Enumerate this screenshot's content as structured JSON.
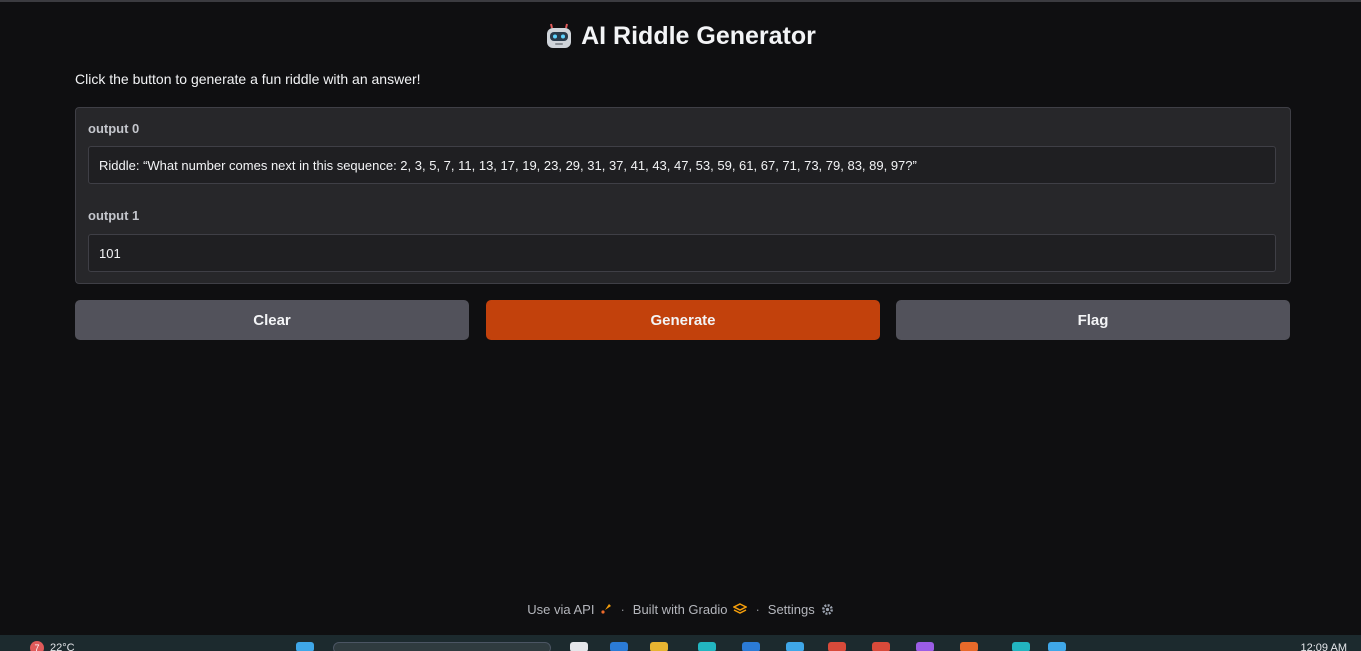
{
  "header": {
    "title": "AI Riddle Generator",
    "icon": "robot-icon"
  },
  "description": "Click the button to generate a fun riddle with an answer!",
  "outputs": [
    {
      "label": "output 0",
      "value": "Riddle: “What number comes next in this sequence: 2, 3, 5, 7, 11, 13, 17, 19, 23, 29, 31, 37, 41, 43, 47, 53, 59, 61, 67, 71, 73, 79, 83, 89, 97?”"
    },
    {
      "label": "output 1",
      "value": "101"
    }
  ],
  "buttons": {
    "clear": "Clear",
    "generate": "Generate",
    "flag": "Flag"
  },
  "footer": {
    "api": "Use via API",
    "gradio": "Built with Gradio",
    "settings": "Settings",
    "separator": "·"
  },
  "taskbar": {
    "weather_badge": "7",
    "temperature": "22°C",
    "clock": "12:09 AM"
  },
  "colors": {
    "primary": "#c2410c",
    "secondary": "#52525b",
    "background": "#0f0f11",
    "panel": "#27272a"
  }
}
